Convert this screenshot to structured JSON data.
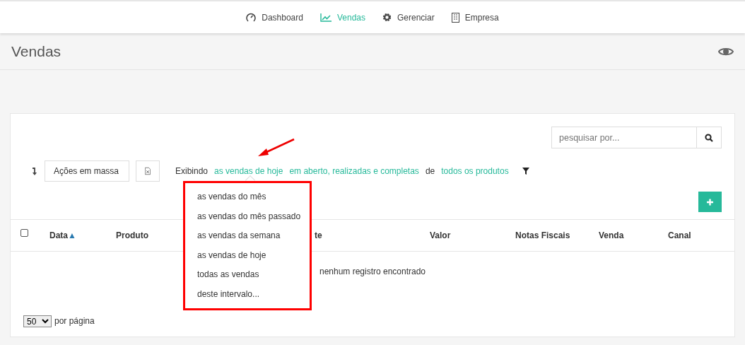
{
  "nav": [
    {
      "label": "Dashboard",
      "selected": false
    },
    {
      "label": "Vendas",
      "selected": true
    },
    {
      "label": "Gerenciar",
      "selected": false
    },
    {
      "label": "Empresa",
      "selected": false
    }
  ],
  "page_title": "Vendas",
  "search": {
    "placeholder": "pesquisar por..."
  },
  "bulk_actions": "Ações em massa",
  "filter": [
    {
      "kind": "text",
      "label": "Exibindo"
    },
    {
      "kind": "link",
      "label": "as vendas de hoje"
    },
    {
      "kind": "link",
      "label": "em aberto, realizadas e completas"
    },
    {
      "kind": "text",
      "label": "de"
    },
    {
      "kind": "link",
      "label": "todos os produtos"
    }
  ],
  "period_menu": [
    "as vendas do mês",
    "as vendas do mês passado",
    "as vendas da semana",
    "as vendas de hoje",
    "todas as vendas",
    "deste intervalo..."
  ],
  "table": {
    "select_all_checked": false,
    "columns": [
      {
        "label": "Data",
        "sort_indicator": "▲"
      },
      {
        "label": "Produto"
      },
      {
        "label": "te"
      },
      {
        "label": "Valor"
      },
      {
        "label": "Notas Fiscais"
      },
      {
        "label": "Venda"
      },
      {
        "label": "Canal"
      }
    ],
    "empty_message": "nenhum registro encontrado"
  },
  "per_page": {
    "value": "50",
    "label": "por página"
  }
}
